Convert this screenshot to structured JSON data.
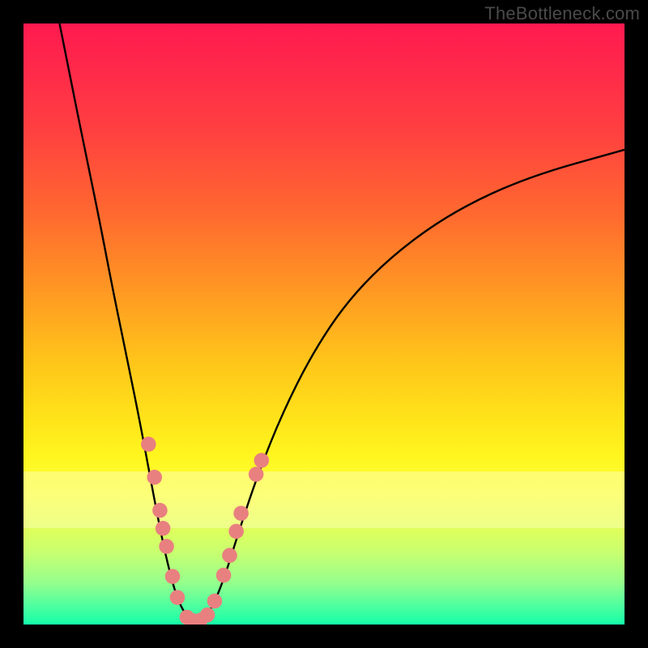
{
  "watermark": "TheBottleneck.com",
  "chart_data": {
    "type": "line",
    "title": "",
    "xlabel": "",
    "ylabel": "",
    "xlim": [
      0,
      100
    ],
    "ylim": [
      0,
      100
    ],
    "grid": false,
    "legend": false,
    "gradient_stops": [
      {
        "pos": 0.0,
        "color": "#ff1a4f"
      },
      {
        "pos": 0.18,
        "color": "#ff4040"
      },
      {
        "pos": 0.45,
        "color": "#ff9a22"
      },
      {
        "pos": 0.66,
        "color": "#ffe41a"
      },
      {
        "pos": 0.78,
        "color": "#fcff3a"
      },
      {
        "pos": 0.93,
        "color": "#96ff8c"
      },
      {
        "pos": 1.0,
        "color": "#15ffa8"
      }
    ],
    "series": [
      {
        "name": "left-curve",
        "stroke": "#000000",
        "points": [
          {
            "x": 6.0,
            "y": 100.0
          },
          {
            "x": 8.0,
            "y": 90.0
          },
          {
            "x": 10.0,
            "y": 80.0
          },
          {
            "x": 12.5,
            "y": 68.0
          },
          {
            "x": 15.0,
            "y": 55.0
          },
          {
            "x": 17.5,
            "y": 43.0
          },
          {
            "x": 19.5,
            "y": 33.0
          },
          {
            "x": 21.0,
            "y": 25.0
          },
          {
            "x": 22.5,
            "y": 17.0
          },
          {
            "x": 24.0,
            "y": 10.0
          },
          {
            "x": 25.5,
            "y": 4.5
          },
          {
            "x": 27.0,
            "y": 1.5
          },
          {
            "x": 28.5,
            "y": 0.5
          }
        ]
      },
      {
        "name": "right-curve",
        "stroke": "#000000",
        "points": [
          {
            "x": 28.5,
            "y": 0.5
          },
          {
            "x": 30.0,
            "y": 1.0
          },
          {
            "x": 31.5,
            "y": 3.0
          },
          {
            "x": 33.5,
            "y": 8.0
          },
          {
            "x": 36.0,
            "y": 16.0
          },
          {
            "x": 39.0,
            "y": 25.0
          },
          {
            "x": 43.0,
            "y": 35.0
          },
          {
            "x": 48.0,
            "y": 45.0
          },
          {
            "x": 54.0,
            "y": 54.0
          },
          {
            "x": 62.0,
            "y": 62.0
          },
          {
            "x": 72.0,
            "y": 69.0
          },
          {
            "x": 84.0,
            "y": 74.5
          },
          {
            "x": 100.0,
            "y": 79.0
          }
        ]
      }
    ],
    "scatter": {
      "name": "dots",
      "color": "#e98080",
      "radius_pct": 1.25,
      "points": [
        {
          "x": 20.8,
          "y": 30.0
        },
        {
          "x": 21.8,
          "y": 24.5
        },
        {
          "x": 22.7,
          "y": 19.0
        },
        {
          "x": 23.2,
          "y": 16.0
        },
        {
          "x": 23.8,
          "y": 13.0
        },
        {
          "x": 24.8,
          "y": 8.0
        },
        {
          "x": 25.6,
          "y": 4.5
        },
        {
          "x": 27.2,
          "y": 1.2
        },
        {
          "x": 28.3,
          "y": 0.6
        },
        {
          "x": 29.4,
          "y": 0.7
        },
        {
          "x": 30.6,
          "y": 1.6
        },
        {
          "x": 31.8,
          "y": 3.9
        },
        {
          "x": 33.3,
          "y": 8.2
        },
        {
          "x": 34.3,
          "y": 11.5
        },
        {
          "x": 35.4,
          "y": 15.5
        },
        {
          "x": 36.2,
          "y": 18.5
        },
        {
          "x": 38.7,
          "y": 25.0
        },
        {
          "x": 39.6,
          "y": 27.3
        }
      ]
    },
    "highlight_band": {
      "y_from": 15.0,
      "y_to": 24.0,
      "color": "rgba(255,255,210,0.4)"
    }
  }
}
